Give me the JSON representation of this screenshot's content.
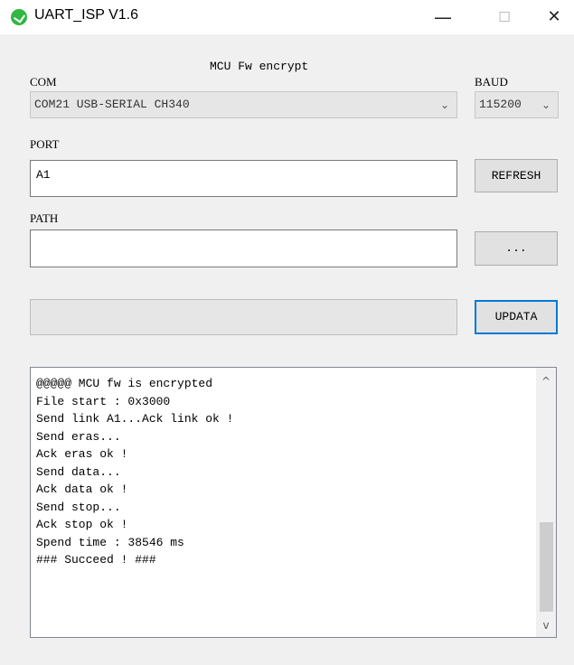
{
  "window": {
    "title": "UART_ISP V1.6",
    "minimize_glyph": "—",
    "maximize_glyph": "☐",
    "close_glyph": "✕"
  },
  "header": {
    "caption": "MCU Fw encrypt"
  },
  "com": {
    "label": "COM",
    "value": "COM21 USB-SERIAL CH340"
  },
  "baud": {
    "label": "BAUD",
    "value": "115200"
  },
  "port": {
    "label": "PORT",
    "value": "A1",
    "refresh_label": "REFRESH"
  },
  "path": {
    "label": "PATH",
    "value": "",
    "browse_label": "..."
  },
  "update": {
    "button_label": "UPDATA",
    "progress_percent": 0
  },
  "log": {
    "lines": [
      "@@@@@ MCU fw is encrypted",
      "File start : 0x3000",
      "Send link A1...Ack link ok !",
      "Send eras...",
      "Ack eras ok !",
      "Send data...",
      "Ack data ok !",
      "Send stop...",
      "Ack stop ok !",
      "Spend time : 38546 ms",
      "### Succeed ! ###"
    ],
    "scroll_up_glyph": "^",
    "scroll_down_glyph": "v",
    "scroll_thumb_start_fraction": 0.59,
    "scroll_thumb_size_fraction": 0.41
  },
  "icons": {
    "app": "app-icon",
    "dropdown": "chevron-down-icon"
  },
  "colors": {
    "accent": "#0078d7",
    "app_icon": "#31b744",
    "progress_fill": "#06b025"
  },
  "chevron_glyph": "⌄"
}
